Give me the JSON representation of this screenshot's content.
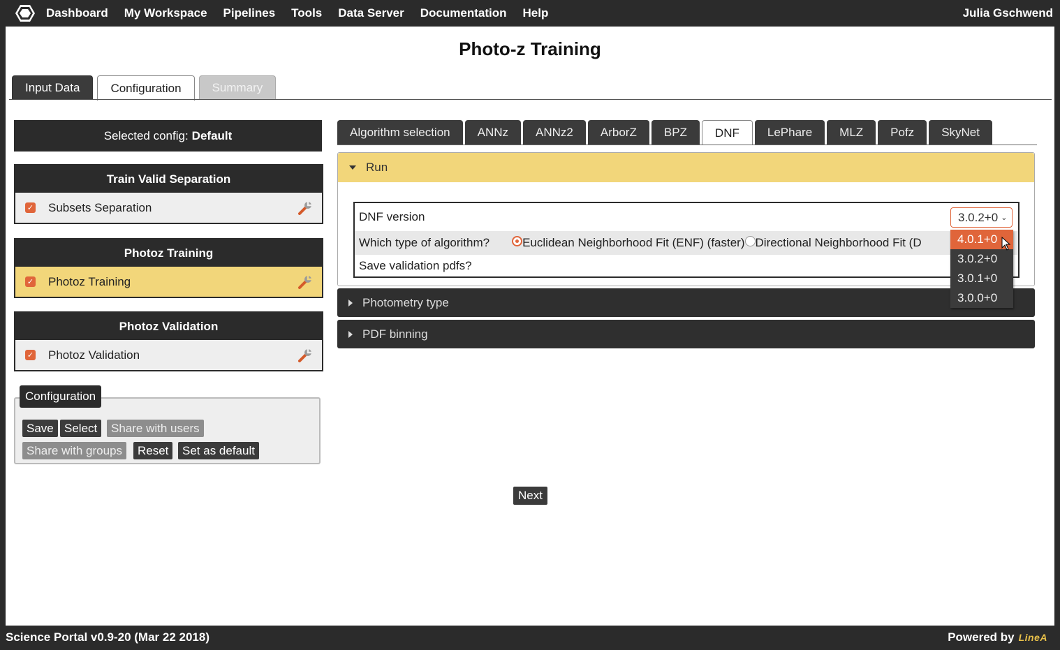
{
  "nav": {
    "items": [
      "Dashboard",
      "My Workspace",
      "Pipelines",
      "Tools",
      "Data Server",
      "Documentation",
      "Help"
    ],
    "user": "Julia Gschwend"
  },
  "page": {
    "title": "Photo-z Training"
  },
  "main_tabs": [
    {
      "label": "Input Data",
      "state": "default"
    },
    {
      "label": "Configuration",
      "state": "active"
    },
    {
      "label": "Summary",
      "state": "disabled"
    }
  ],
  "left": {
    "selected_prefix": "Selected config:",
    "selected_name": "Default",
    "groups": [
      {
        "title": "Train Valid Separation",
        "item": "Subsets Separation",
        "checked": true,
        "highlighted": false
      },
      {
        "title": "Photoz Training",
        "item": "Photoz Training",
        "checked": true,
        "highlighted": true
      },
      {
        "title": "Photoz Validation",
        "item": "Photoz Validation",
        "checked": true,
        "highlighted": false
      }
    ],
    "config_box": {
      "legend": "Configuration",
      "save": "Save",
      "select": "Select",
      "share_users": "Share with users",
      "share_groups": "Share with groups",
      "reset": "Reset",
      "set_default": "Set as default"
    }
  },
  "algo_tabs": [
    "Algorithm selection",
    "ANNz",
    "ANNz2",
    "ArborZ",
    "BPZ",
    "DNF",
    "LePhare",
    "MLZ",
    "Pofz",
    "SkyNet"
  ],
  "algo_active": "DNF",
  "run": {
    "header": "Run",
    "dnf_version_label": "DNF version",
    "dnf_version_value": "3.0.2+0",
    "algorithm_label": "Which type of algorithm?",
    "algorithm_enf": "Euclidean Neighborhood Fit (ENF) (faster)",
    "algorithm_dnf": "Directional Neighborhood Fit (D",
    "save_pdfs_label": "Save validation pdfs?",
    "version_options": [
      "4.0.1+0",
      "3.0.2+0",
      "3.0.1+0",
      "3.0.0+0"
    ],
    "highlighted_option": "4.0.1+0"
  },
  "sections": {
    "photometry": "Photometry type",
    "pdf_binning": "PDF binning"
  },
  "next_label": "Next",
  "footer": {
    "version": "Science Portal v0.9-20 (Mar 22 2018)",
    "powered_by": "Powered by",
    "brand": "LineA"
  },
  "colors": {
    "accent": "#e0653a",
    "highlight": "#f2d67a",
    "dark": "#2b2b2b"
  }
}
